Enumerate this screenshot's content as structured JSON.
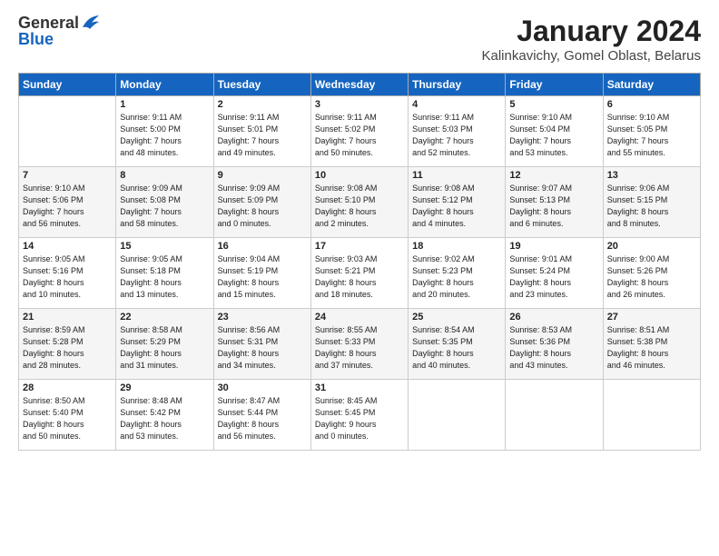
{
  "logo": {
    "general": "General",
    "blue": "Blue"
  },
  "title": "January 2024",
  "subtitle": "Kalinkavichy, Gomel Oblast, Belarus",
  "days_header": [
    "Sunday",
    "Monday",
    "Tuesday",
    "Wednesday",
    "Thursday",
    "Friday",
    "Saturday"
  ],
  "weeks": [
    {
      "shaded": false,
      "days": [
        {
          "num": "",
          "info": ""
        },
        {
          "num": "1",
          "info": "Sunrise: 9:11 AM\nSunset: 5:00 PM\nDaylight: 7 hours\nand 48 minutes."
        },
        {
          "num": "2",
          "info": "Sunrise: 9:11 AM\nSunset: 5:01 PM\nDaylight: 7 hours\nand 49 minutes."
        },
        {
          "num": "3",
          "info": "Sunrise: 9:11 AM\nSunset: 5:02 PM\nDaylight: 7 hours\nand 50 minutes."
        },
        {
          "num": "4",
          "info": "Sunrise: 9:11 AM\nSunset: 5:03 PM\nDaylight: 7 hours\nand 52 minutes."
        },
        {
          "num": "5",
          "info": "Sunrise: 9:10 AM\nSunset: 5:04 PM\nDaylight: 7 hours\nand 53 minutes."
        },
        {
          "num": "6",
          "info": "Sunrise: 9:10 AM\nSunset: 5:05 PM\nDaylight: 7 hours\nand 55 minutes."
        }
      ]
    },
    {
      "shaded": true,
      "days": [
        {
          "num": "7",
          "info": "Sunrise: 9:10 AM\nSunset: 5:06 PM\nDaylight: 7 hours\nand 56 minutes."
        },
        {
          "num": "8",
          "info": "Sunrise: 9:09 AM\nSunset: 5:08 PM\nDaylight: 7 hours\nand 58 minutes."
        },
        {
          "num": "9",
          "info": "Sunrise: 9:09 AM\nSunset: 5:09 PM\nDaylight: 8 hours\nand 0 minutes."
        },
        {
          "num": "10",
          "info": "Sunrise: 9:08 AM\nSunset: 5:10 PM\nDaylight: 8 hours\nand 2 minutes."
        },
        {
          "num": "11",
          "info": "Sunrise: 9:08 AM\nSunset: 5:12 PM\nDaylight: 8 hours\nand 4 minutes."
        },
        {
          "num": "12",
          "info": "Sunrise: 9:07 AM\nSunset: 5:13 PM\nDaylight: 8 hours\nand 6 minutes."
        },
        {
          "num": "13",
          "info": "Sunrise: 9:06 AM\nSunset: 5:15 PM\nDaylight: 8 hours\nand 8 minutes."
        }
      ]
    },
    {
      "shaded": false,
      "days": [
        {
          "num": "14",
          "info": "Sunrise: 9:05 AM\nSunset: 5:16 PM\nDaylight: 8 hours\nand 10 minutes."
        },
        {
          "num": "15",
          "info": "Sunrise: 9:05 AM\nSunset: 5:18 PM\nDaylight: 8 hours\nand 13 minutes."
        },
        {
          "num": "16",
          "info": "Sunrise: 9:04 AM\nSunset: 5:19 PM\nDaylight: 8 hours\nand 15 minutes."
        },
        {
          "num": "17",
          "info": "Sunrise: 9:03 AM\nSunset: 5:21 PM\nDaylight: 8 hours\nand 18 minutes."
        },
        {
          "num": "18",
          "info": "Sunrise: 9:02 AM\nSunset: 5:23 PM\nDaylight: 8 hours\nand 20 minutes."
        },
        {
          "num": "19",
          "info": "Sunrise: 9:01 AM\nSunset: 5:24 PM\nDaylight: 8 hours\nand 23 minutes."
        },
        {
          "num": "20",
          "info": "Sunrise: 9:00 AM\nSunset: 5:26 PM\nDaylight: 8 hours\nand 26 minutes."
        }
      ]
    },
    {
      "shaded": true,
      "days": [
        {
          "num": "21",
          "info": "Sunrise: 8:59 AM\nSunset: 5:28 PM\nDaylight: 8 hours\nand 28 minutes."
        },
        {
          "num": "22",
          "info": "Sunrise: 8:58 AM\nSunset: 5:29 PM\nDaylight: 8 hours\nand 31 minutes."
        },
        {
          "num": "23",
          "info": "Sunrise: 8:56 AM\nSunset: 5:31 PM\nDaylight: 8 hours\nand 34 minutes."
        },
        {
          "num": "24",
          "info": "Sunrise: 8:55 AM\nSunset: 5:33 PM\nDaylight: 8 hours\nand 37 minutes."
        },
        {
          "num": "25",
          "info": "Sunrise: 8:54 AM\nSunset: 5:35 PM\nDaylight: 8 hours\nand 40 minutes."
        },
        {
          "num": "26",
          "info": "Sunrise: 8:53 AM\nSunset: 5:36 PM\nDaylight: 8 hours\nand 43 minutes."
        },
        {
          "num": "27",
          "info": "Sunrise: 8:51 AM\nSunset: 5:38 PM\nDaylight: 8 hours\nand 46 minutes."
        }
      ]
    },
    {
      "shaded": false,
      "days": [
        {
          "num": "28",
          "info": "Sunrise: 8:50 AM\nSunset: 5:40 PM\nDaylight: 8 hours\nand 50 minutes."
        },
        {
          "num": "29",
          "info": "Sunrise: 8:48 AM\nSunset: 5:42 PM\nDaylight: 8 hours\nand 53 minutes."
        },
        {
          "num": "30",
          "info": "Sunrise: 8:47 AM\nSunset: 5:44 PM\nDaylight: 8 hours\nand 56 minutes."
        },
        {
          "num": "31",
          "info": "Sunrise: 8:45 AM\nSunset: 5:45 PM\nDaylight: 9 hours\nand 0 minutes."
        },
        {
          "num": "",
          "info": ""
        },
        {
          "num": "",
          "info": ""
        },
        {
          "num": "",
          "info": ""
        }
      ]
    }
  ]
}
